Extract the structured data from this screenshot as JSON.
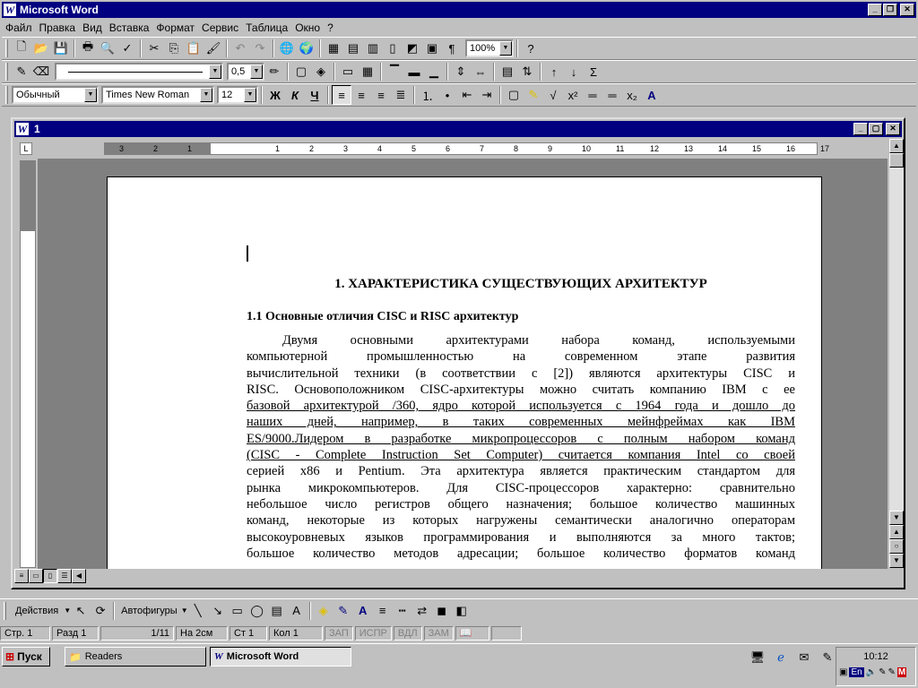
{
  "app": {
    "title": "Microsoft Word",
    "menu": [
      "Файл",
      "Правка",
      "Вид",
      "Вставка",
      "Формат",
      "Сервис",
      "Таблица",
      "Окно",
      "?"
    ]
  },
  "toolbar": {
    "zoom": "100%",
    "line_width": "0,5",
    "style": "Обычный",
    "font": "Times New Roman",
    "size": "12",
    "bold": "Ж",
    "italic": "К",
    "underline": "Ч",
    "sigma": "Σ"
  },
  "document": {
    "window_title": "1",
    "heading1": "1.  ХАРАКТЕРИСТИКА СУЩЕСТВУЮЩИХ АРХИТЕКТУР",
    "heading2": "1.1  Основные отличия CISC и  RISC  архитектур",
    "lines": [
      "Двумя основными архитектурами набора команд, используемыми",
      "компьютерной промышленностью на современном этапе развития",
      "вычислительной техники (в соответствии с [2]) являются архитектуры CISC и",
      "RISC. Основоположником CISC-архитектуры можно считать компанию IBM с ее",
      "базовой архитектурой /360, ядро которой используется с 1964 года и дошло до",
      "наших дней, например, в таких современных мейнфреймах как IBM",
      "ES/9000.Лидером в разработке микропроцессоров с полным набором команд",
      "(CISC - Complete Instruction Set Computer) считается компания Intel со своей",
      "серией х86 и Pentium. Эта архитектура является практическим стандартом для",
      "рынка микрокомпьютеров. Для CISC-процессоров характерно: сравнительно",
      "небольшое число регистров общего назначения; большое количество машинных",
      "команд, некоторые из которых нагружены семантически аналогично операторам",
      "высокоуровневых языков программирования и выполняются за много тактов;",
      "большое количество методов адресации; большое количество форматов команд"
    ],
    "ruler_numbers": [
      "3",
      "2",
      "1",
      "1",
      "2",
      "3",
      "4",
      "5",
      "6",
      "7",
      "8",
      "9",
      "10",
      "11",
      "12",
      "13",
      "14",
      "15",
      "16",
      "17"
    ]
  },
  "drawing": {
    "actions": "Действия",
    "autoshapes": "Автофигуры"
  },
  "status": {
    "page": "Стр. 1",
    "section": "Разд 1",
    "pages": "1/11",
    "at": "На 2см",
    "line": "Ст 1",
    "col": "Кол 1",
    "rec": "ЗАП",
    "trk": "ИСПР",
    "ext": "ВДЛ",
    "ovr": "ЗАМ"
  },
  "taskbar": {
    "start": "Пуск",
    "tasks": [
      "Readers",
      "Microsoft Word"
    ],
    "lang": "En",
    "time": "10:12"
  }
}
